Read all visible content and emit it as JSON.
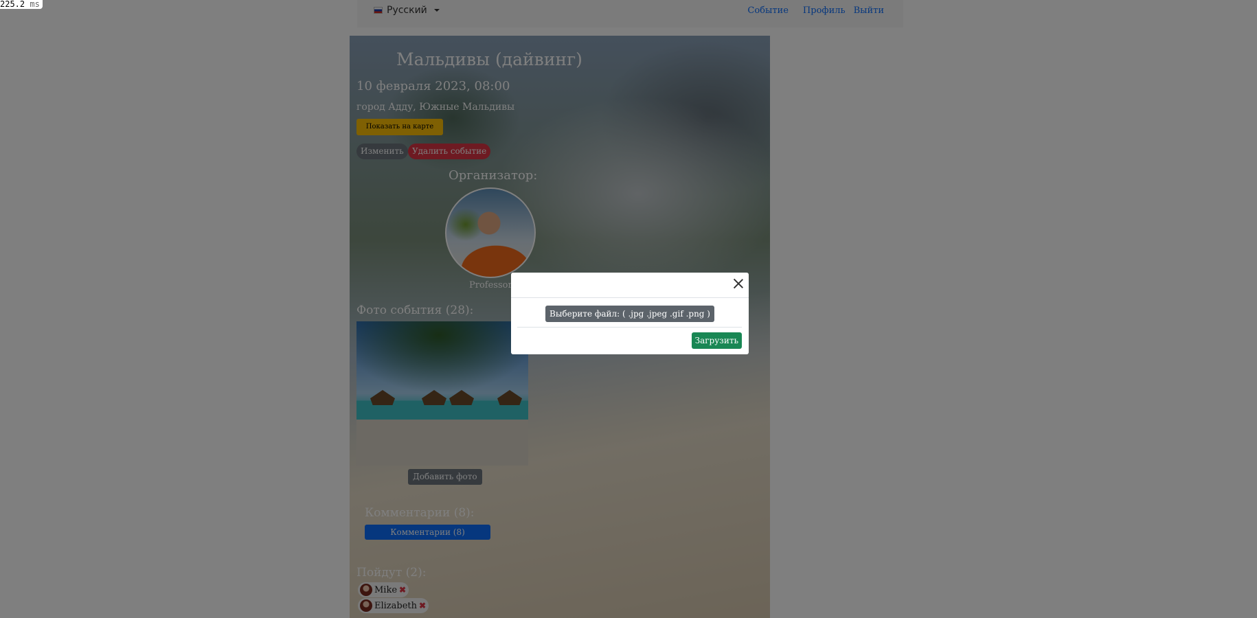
{
  "timer": {
    "value": "225.2",
    "unit": "ms"
  },
  "navbar": {
    "language": "Русский",
    "links": [
      "Событие",
      "Профиль",
      "Выйти"
    ]
  },
  "event": {
    "title": "Мальдивы (дайвинг)",
    "date": "10 февраля 2023, 08:00",
    "place": "город Адду, Южные Мальдивы",
    "map_button": "Показать на карте",
    "edit_button": "Изменить",
    "delete_button": "Удалить событие",
    "organizer_heading": "Организатор:",
    "organizer_name": "Professor",
    "photos_heading": "Фото события (28):",
    "add_photo_button": "Добавить фото",
    "comments_heading": "Комментарии (8):",
    "comments_button": "Комментарии (8)",
    "going_heading": "Пойдут (2):",
    "participants": [
      {
        "name": "Mike"
      },
      {
        "name": "Elizabeth"
      }
    ]
  },
  "modal": {
    "file_button": "Выберите файл: ( .jpg .jpeg .gif .png )",
    "upload_button": "Загрузить"
  },
  "colors": {
    "primary": "#0d6efd",
    "warning": "#ffc107",
    "danger": "#dc3545",
    "success": "#198754",
    "secondary": "#6c757d"
  }
}
